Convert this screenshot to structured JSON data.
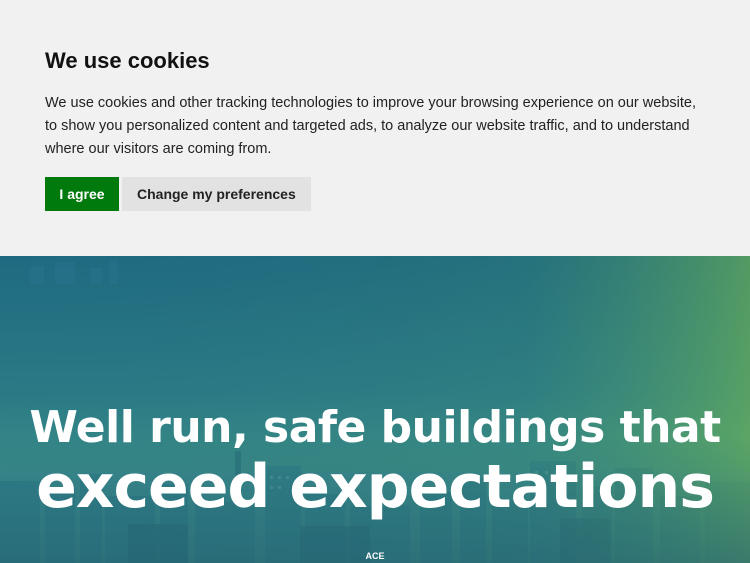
{
  "cookie_banner": {
    "title": "We use cookies",
    "text": "We use cookies and other tracking technologies to improve your browsing experience on our website, to show you personalized content and targeted ads, to analyze our website traffic, and to understand where our visitors are coming from.",
    "agree_label": "I agree",
    "preferences_label": "Change my preferences",
    "agree_color": "#007a0c",
    "background_color": "#f1f1f1"
  },
  "hero": {
    "headline_line1": "Well run, safe buildings that",
    "headline_line2": "exceed expectations",
    "logo_text": "ACE",
    "tint_color": "#1f6a80"
  }
}
